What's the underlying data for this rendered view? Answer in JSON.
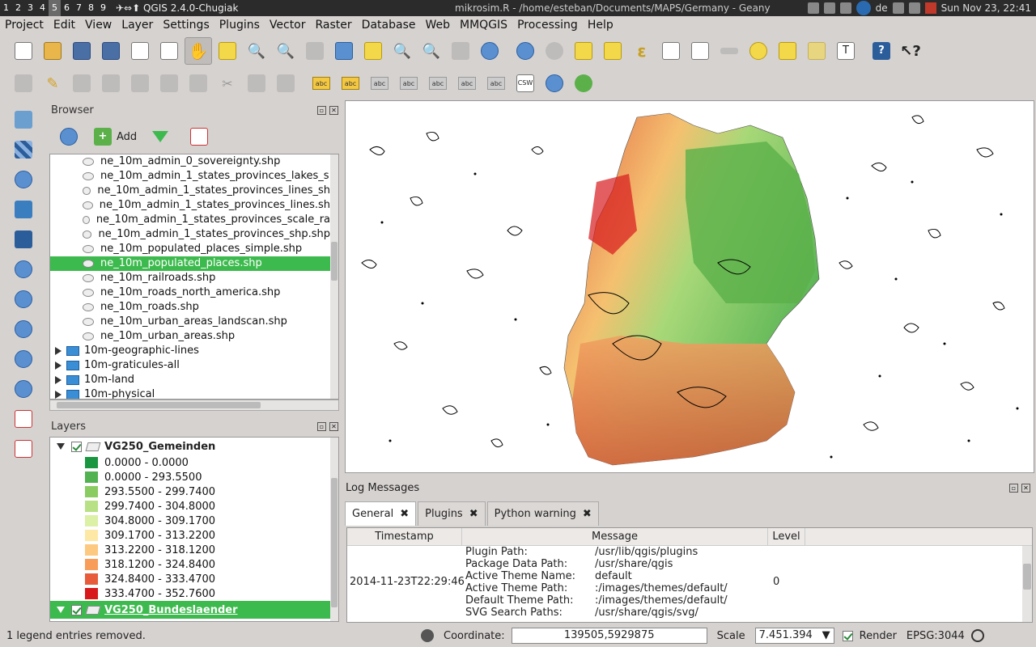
{
  "system_bar": {
    "workspaces": [
      "1",
      "2",
      "3",
      "4",
      "5",
      "6",
      "7",
      "8",
      "9"
    ],
    "active_workspace": "5",
    "window_title": "✈⇔⬆ QGIS 2.4.0-Chugiak",
    "second_window": "mikrosim.R - /home/esteban/Documents/MAPS/Germany - Geany",
    "keyboard": "de",
    "clock": "Sun Nov 23, 22:41"
  },
  "menu": [
    "Project",
    "Edit",
    "View",
    "Layer",
    "Settings",
    "Plugins",
    "Vector",
    "Raster",
    "Database",
    "Web",
    "MMQGIS",
    "Processing",
    "Help"
  ],
  "toolbar2": {
    "label_icons": [
      "abc",
      "abc",
      "abc",
      "abc",
      "abc",
      "abc",
      "abc"
    ],
    "csw": "CSW"
  },
  "browser": {
    "title": "Browser",
    "add_label": "Add",
    "items": [
      {
        "name": "ne_10m_admin_0_sovereignty.shp",
        "type": "file"
      },
      {
        "name": "ne_10m_admin_1_states_provinces_lakes_s",
        "type": "file"
      },
      {
        "name": "ne_10m_admin_1_states_provinces_lines_sh",
        "type": "file"
      },
      {
        "name": "ne_10m_admin_1_states_provinces_lines.sh",
        "type": "file"
      },
      {
        "name": "ne_10m_admin_1_states_provinces_scale_ra",
        "type": "file"
      },
      {
        "name": "ne_10m_admin_1_states_provinces_shp.shp",
        "type": "file"
      },
      {
        "name": "ne_10m_populated_places_simple.shp",
        "type": "file"
      },
      {
        "name": "ne_10m_populated_places.shp",
        "type": "file",
        "selected": true
      },
      {
        "name": "ne_10m_railroads.shp",
        "type": "file"
      },
      {
        "name": "ne_10m_roads_north_america.shp",
        "type": "file"
      },
      {
        "name": "ne_10m_roads.shp",
        "type": "file"
      },
      {
        "name": "ne_10m_urban_areas_landscan.shp",
        "type": "file"
      },
      {
        "name": "ne_10m_urban_areas.shp",
        "type": "file"
      },
      {
        "name": "10m-geographic-lines",
        "type": "folder"
      },
      {
        "name": "10m-graticules-all",
        "type": "folder"
      },
      {
        "name": "10m-land",
        "type": "folder"
      },
      {
        "name": "10m-physical",
        "type": "folder"
      }
    ]
  },
  "layers": {
    "title": "Layers",
    "layer1": "VG250_Gemeinden",
    "legend": [
      {
        "label": "0.0000 - 0.0000",
        "color": "#1a9641"
      },
      {
        "label": "0.0000 - 293.5500",
        "color": "#52b151"
      },
      {
        "label": "293.5500 - 299.7400",
        "color": "#8acc62"
      },
      {
        "label": "299.7400 - 304.8000",
        "color": "#b8e186"
      },
      {
        "label": "304.8000 - 309.1700",
        "color": "#dcf0a6"
      },
      {
        "label": "309.1700 - 313.2200",
        "color": "#fee8a6"
      },
      {
        "label": "313.2200 - 318.1200",
        "color": "#fdc980"
      },
      {
        "label": "318.1200 - 324.8400",
        "color": "#f89d59"
      },
      {
        "label": "324.8400 - 333.4700",
        "color": "#e75b3a"
      },
      {
        "label": "333.4700 - 352.7600",
        "color": "#d7191c"
      }
    ],
    "layer2": "VG250_Bundeslaender"
  },
  "log": {
    "title": "Log Messages",
    "tabs": [
      "General",
      "Plugins",
      "Python warning"
    ],
    "columns": [
      "Timestamp",
      "Message",
      "Level"
    ],
    "timestamp": "2014-11-23T22:29:46",
    "level": "0",
    "messages": [
      {
        "key": "Plugin Path:",
        "value": "/usr/lib/qgis/plugins"
      },
      {
        "key": "Package Data Path:",
        "value": "/usr/share/qgis"
      },
      {
        "key": "Active Theme Name:",
        "value": "default"
      },
      {
        "key": "Active Theme Path:",
        "value": ":/images/themes/default/"
      },
      {
        "key": "Default Theme Path:",
        "value": ":/images/themes/default/"
      },
      {
        "key": "SVG Search Paths:",
        "value": "/usr/share/qgis/svg/"
      }
    ]
  },
  "status": {
    "message": "1 legend entries removed.",
    "coordinate_label": "Coordinate:",
    "coordinate": "139505,5929875",
    "scale_label": "Scale",
    "scale": "7.451.394",
    "render_label": "Render",
    "crs": "EPSG:3044"
  }
}
